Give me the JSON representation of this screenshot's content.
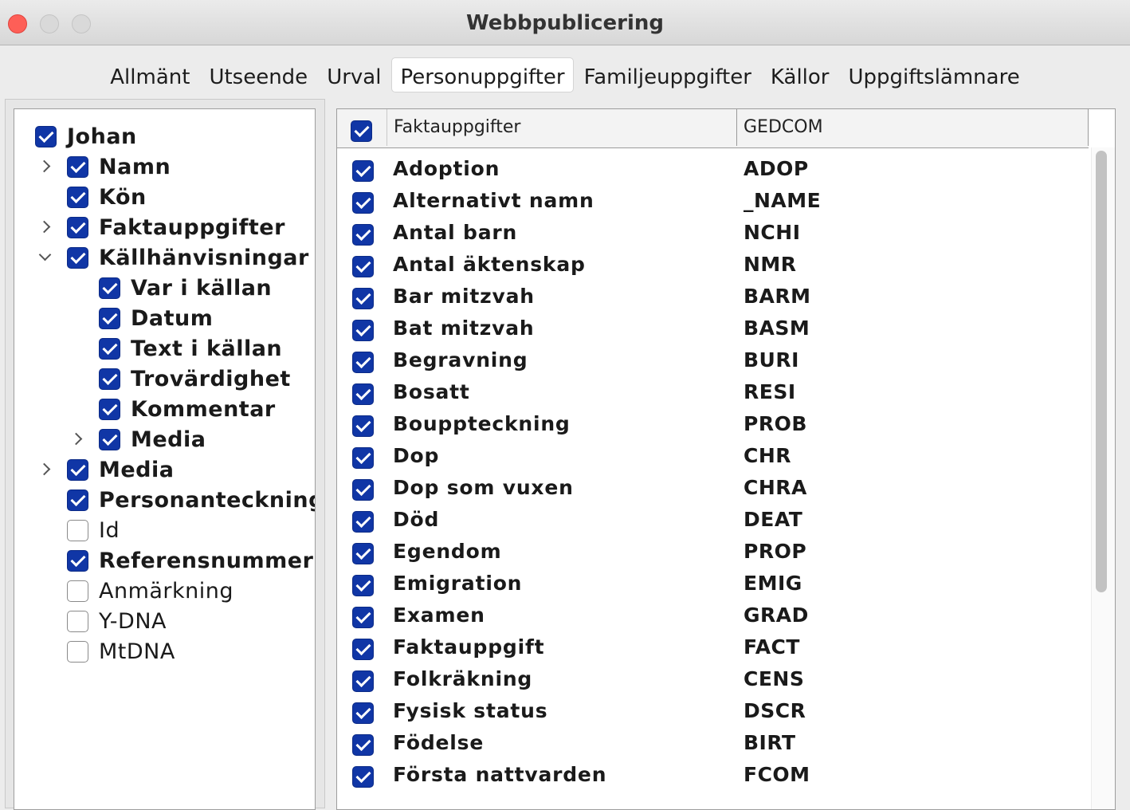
{
  "window": {
    "title": "Webbpublicering"
  },
  "tabs": [
    {
      "label": "Allmänt",
      "active": false
    },
    {
      "label": "Utseende",
      "active": false
    },
    {
      "label": "Urval",
      "active": false
    },
    {
      "label": "Personuppgifter",
      "active": true
    },
    {
      "label": "Familjeuppgifter",
      "active": false
    },
    {
      "label": "Källor",
      "active": false
    },
    {
      "label": "Uppgiftslämnare",
      "active": false
    }
  ],
  "tree": {
    "items": [
      {
        "label": "Johan",
        "checked": true,
        "bold": true,
        "level": 0,
        "expander": "none"
      },
      {
        "label": "Namn",
        "checked": true,
        "bold": true,
        "level": 1,
        "expander": "collapsed"
      },
      {
        "label": "Kön",
        "checked": true,
        "bold": true,
        "level": 1,
        "expander": "none"
      },
      {
        "label": "Faktauppgifter",
        "checked": true,
        "bold": true,
        "level": 1,
        "expander": "collapsed"
      },
      {
        "label": "Källhänvisningar",
        "checked": true,
        "bold": true,
        "level": 1,
        "expander": "expanded"
      },
      {
        "label": "Var i källan",
        "checked": true,
        "bold": true,
        "level": 2,
        "expander": "none"
      },
      {
        "label": "Datum",
        "checked": true,
        "bold": true,
        "level": 2,
        "expander": "none"
      },
      {
        "label": "Text i källan",
        "checked": true,
        "bold": true,
        "level": 2,
        "expander": "none"
      },
      {
        "label": "Trovärdighet",
        "checked": true,
        "bold": true,
        "level": 2,
        "expander": "none"
      },
      {
        "label": "Kommentar",
        "checked": true,
        "bold": true,
        "level": 2,
        "expander": "none"
      },
      {
        "label": "Media",
        "checked": true,
        "bold": true,
        "level": 2,
        "expander": "collapsed"
      },
      {
        "label": "Media",
        "checked": true,
        "bold": true,
        "level": 1,
        "expander": "collapsed"
      },
      {
        "label": "Personanteckningar",
        "checked": true,
        "bold": true,
        "level": 1,
        "expander": "none"
      },
      {
        "label": "Id",
        "checked": false,
        "bold": false,
        "level": 1,
        "expander": "none"
      },
      {
        "label": "Referensnummer",
        "checked": true,
        "bold": true,
        "level": 1,
        "expander": "none"
      },
      {
        "label": "Anmärkning",
        "checked": false,
        "bold": false,
        "level": 1,
        "expander": "none"
      },
      {
        "label": "Y-DNA",
        "checked": false,
        "bold": false,
        "level": 1,
        "expander": "none"
      },
      {
        "label": "MtDNA",
        "checked": false,
        "bold": false,
        "level": 1,
        "expander": "none"
      }
    ]
  },
  "facts_table": {
    "header_checked": true,
    "columns": [
      "Faktauppgifter",
      "GEDCOM"
    ],
    "rows": [
      {
        "name": "Adoption",
        "code": "ADOP",
        "checked": true
      },
      {
        "name": "Alternativt namn",
        "code": "_NAME",
        "checked": true
      },
      {
        "name": "Antal barn",
        "code": "NCHI",
        "checked": true
      },
      {
        "name": "Antal äktenskap",
        "code": "NMR",
        "checked": true
      },
      {
        "name": "Bar mitzvah",
        "code": "BARM",
        "checked": true
      },
      {
        "name": "Bat mitzvah",
        "code": "BASM",
        "checked": true
      },
      {
        "name": "Begravning",
        "code": "BURI",
        "checked": true
      },
      {
        "name": "Bosatt",
        "code": "RESI",
        "checked": true
      },
      {
        "name": "Bouppteckning",
        "code": "PROB",
        "checked": true
      },
      {
        "name": "Dop",
        "code": "CHR",
        "checked": true
      },
      {
        "name": "Dop som vuxen",
        "code": "CHRA",
        "checked": true
      },
      {
        "name": "Död",
        "code": "DEAT",
        "checked": true
      },
      {
        "name": "Egendom",
        "code": "PROP",
        "checked": true
      },
      {
        "name": "Emigration",
        "code": "EMIG",
        "checked": true
      },
      {
        "name": "Examen",
        "code": "GRAD",
        "checked": true
      },
      {
        "name": "Faktauppgift",
        "code": "FACT",
        "checked": true
      },
      {
        "name": "Folkräkning",
        "code": "CENS",
        "checked": true
      },
      {
        "name": "Fysisk status",
        "code": "DSCR",
        "checked": true
      },
      {
        "name": "Födelse",
        "code": "BIRT",
        "checked": true
      },
      {
        "name": "Första nattvarden",
        "code": "FCOM",
        "checked": true
      }
    ]
  },
  "colors": {
    "checkbox_checked": "#1036a6",
    "close_button": "#fe5f57"
  }
}
